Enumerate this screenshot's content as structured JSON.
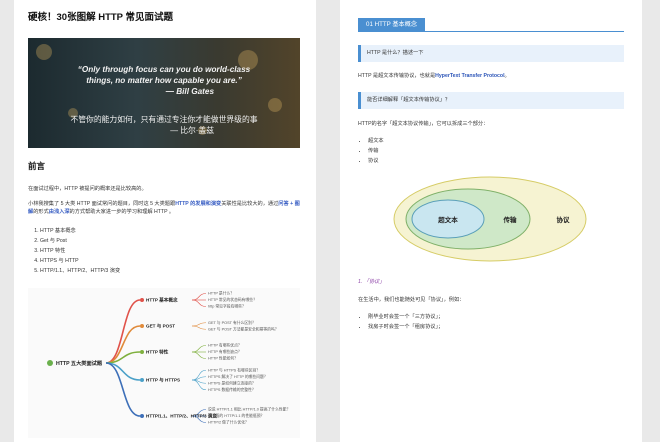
{
  "left": {
    "title": "硬核！30张图解 HTTP 常见面试题",
    "banner": {
      "quote_en_1": "“Only through focus can you do world-class",
      "quote_en_2": "things, no matter how capable you are.”",
      "quote_en_3": "— Bill Gates",
      "quote_cn_1": "不管你的能力如何，只有通过专注你才能做世界级的事",
      "quote_cn_2": "— 比尔·盖兹"
    },
    "section_title": "前言",
    "intro_1": "在面试过程中，HTTP 被提问的概率还是比较高的。",
    "intro_2a": "小林我搜集了 5 大类 HTTP 面试常问的题目，同时这 5 大类题跟",
    "intro_2b": "HTTP 的发展和演变",
    "intro_2c": "关联性是比较大的，通过",
    "intro_2d": "问答 + 图解",
    "intro_2e": "的形式",
    "intro_2f": "由浅入深",
    "intro_2g": "的方式帮助大家进一步的学习和理解 HTTP 。",
    "toc": [
      "HTTP 基本概念",
      "Get 与 Post",
      "HTTP 特性",
      "HTTPS 与 HTTP",
      "HTTP/1.1、HTTP/2、HTTP/3 演变"
    ],
    "mindmap": {
      "root": "HTTP 五大类面试题",
      "branches": [
        {
          "label": "HTTP 基本概念",
          "color": "#e0524a",
          "leaves": [
            "HTTP 是什么？",
            "HTTP 常见的状态码有哪些？",
            "http 常见字段有哪些？"
          ]
        },
        {
          "label": "GET 与 POST",
          "color": "#e08a3a",
          "leaves": [
            "GET 与 POST 有什么区别？",
            "GET 与 POST 方法都是安全和幂等的吗？"
          ]
        },
        {
          "label": "HTTP 特性",
          "color": "#7fb03e",
          "leaves": [
            "HTTP 有哪些优点？",
            "HTTP 有哪些缺点？",
            "HTTP 性能如何？"
          ]
        },
        {
          "label": "HTTP 与 HTTPS",
          "color": "#4aa0c8",
          "leaves": [
            "HTTP 与 HTTPS 有哪些区别？",
            "HTTPS 解决了 HTTP 的哪些问题？",
            "HTTPS 是如何建立连接的？",
            "HTTPS 数据传输的完整性？"
          ]
        },
        {
          "label": "HTTP/1.1、HTTP/2、HTTP/3 演变",
          "color": "#3d6fb8",
          "leaves": [
            "说说 HTTP/1.1 相比 HTTP/1.0 提高了什么性能？",
            "那上面的 HTTP/1.1 的性能瓶颈？",
            "HTTP/2 做了什么优化？"
          ]
        }
      ]
    }
  },
  "right": {
    "section_label": "01 HTTP 基本概念",
    "q1": "HTTP 是什么？描述一下",
    "a1a": "HTTP 是超文本传输协议，也就是",
    "a1b": "HyperText Transfer Protocol",
    "a1c": "。",
    "q2": "能否详细解释「超文本传输协议」？",
    "a2": "HTTP的名字「超文本协议传输」，它可以拆成三个部分：",
    "parts": [
      "超文本",
      "传输",
      "协议"
    ],
    "venn": {
      "outer": "协议",
      "middle": "传输",
      "inner": "超文本"
    },
    "numbered": "1. 「协议」",
    "a3": "在生活中，我们也能随处可见「协议」，例如：",
    "examples": [
      "刚毕业时会签一个「三方协议」；",
      "找房子时会签一个「租房协议」；"
    ]
  },
  "colors": {
    "accent": "#4a8fd1",
    "venn_outer": "#f6f3d2",
    "venn_middle": "#cfe8c8",
    "venn_inner": "#c9e6f0"
  }
}
